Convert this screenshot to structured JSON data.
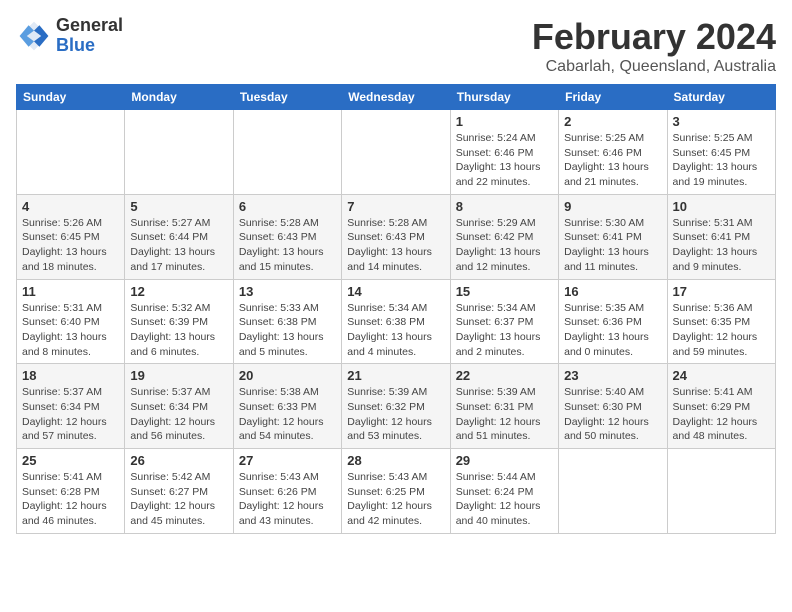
{
  "logo": {
    "general": "General",
    "blue": "Blue"
  },
  "title": "February 2024",
  "location": "Cabarlah, Queensland, Australia",
  "weekdays": [
    "Sunday",
    "Monday",
    "Tuesday",
    "Wednesday",
    "Thursday",
    "Friday",
    "Saturday"
  ],
  "weeks": [
    [
      {
        "day": "",
        "info": ""
      },
      {
        "day": "",
        "info": ""
      },
      {
        "day": "",
        "info": ""
      },
      {
        "day": "",
        "info": ""
      },
      {
        "day": "1",
        "info": "Sunrise: 5:24 AM\nSunset: 6:46 PM\nDaylight: 13 hours\nand 22 minutes."
      },
      {
        "day": "2",
        "info": "Sunrise: 5:25 AM\nSunset: 6:46 PM\nDaylight: 13 hours\nand 21 minutes."
      },
      {
        "day": "3",
        "info": "Sunrise: 5:25 AM\nSunset: 6:45 PM\nDaylight: 13 hours\nand 19 minutes."
      }
    ],
    [
      {
        "day": "4",
        "info": "Sunrise: 5:26 AM\nSunset: 6:45 PM\nDaylight: 13 hours\nand 18 minutes."
      },
      {
        "day": "5",
        "info": "Sunrise: 5:27 AM\nSunset: 6:44 PM\nDaylight: 13 hours\nand 17 minutes."
      },
      {
        "day": "6",
        "info": "Sunrise: 5:28 AM\nSunset: 6:43 PM\nDaylight: 13 hours\nand 15 minutes."
      },
      {
        "day": "7",
        "info": "Sunrise: 5:28 AM\nSunset: 6:43 PM\nDaylight: 13 hours\nand 14 minutes."
      },
      {
        "day": "8",
        "info": "Sunrise: 5:29 AM\nSunset: 6:42 PM\nDaylight: 13 hours\nand 12 minutes."
      },
      {
        "day": "9",
        "info": "Sunrise: 5:30 AM\nSunset: 6:41 PM\nDaylight: 13 hours\nand 11 minutes."
      },
      {
        "day": "10",
        "info": "Sunrise: 5:31 AM\nSunset: 6:41 PM\nDaylight: 13 hours\nand 9 minutes."
      }
    ],
    [
      {
        "day": "11",
        "info": "Sunrise: 5:31 AM\nSunset: 6:40 PM\nDaylight: 13 hours\nand 8 minutes."
      },
      {
        "day": "12",
        "info": "Sunrise: 5:32 AM\nSunset: 6:39 PM\nDaylight: 13 hours\nand 6 minutes."
      },
      {
        "day": "13",
        "info": "Sunrise: 5:33 AM\nSunset: 6:38 PM\nDaylight: 13 hours\nand 5 minutes."
      },
      {
        "day": "14",
        "info": "Sunrise: 5:34 AM\nSunset: 6:38 PM\nDaylight: 13 hours\nand 4 minutes."
      },
      {
        "day": "15",
        "info": "Sunrise: 5:34 AM\nSunset: 6:37 PM\nDaylight: 13 hours\nand 2 minutes."
      },
      {
        "day": "16",
        "info": "Sunrise: 5:35 AM\nSunset: 6:36 PM\nDaylight: 13 hours\nand 0 minutes."
      },
      {
        "day": "17",
        "info": "Sunrise: 5:36 AM\nSunset: 6:35 PM\nDaylight: 12 hours\nand 59 minutes."
      }
    ],
    [
      {
        "day": "18",
        "info": "Sunrise: 5:37 AM\nSunset: 6:34 PM\nDaylight: 12 hours\nand 57 minutes."
      },
      {
        "day": "19",
        "info": "Sunrise: 5:37 AM\nSunset: 6:34 PM\nDaylight: 12 hours\nand 56 minutes."
      },
      {
        "day": "20",
        "info": "Sunrise: 5:38 AM\nSunset: 6:33 PM\nDaylight: 12 hours\nand 54 minutes."
      },
      {
        "day": "21",
        "info": "Sunrise: 5:39 AM\nSunset: 6:32 PM\nDaylight: 12 hours\nand 53 minutes."
      },
      {
        "day": "22",
        "info": "Sunrise: 5:39 AM\nSunset: 6:31 PM\nDaylight: 12 hours\nand 51 minutes."
      },
      {
        "day": "23",
        "info": "Sunrise: 5:40 AM\nSunset: 6:30 PM\nDaylight: 12 hours\nand 50 minutes."
      },
      {
        "day": "24",
        "info": "Sunrise: 5:41 AM\nSunset: 6:29 PM\nDaylight: 12 hours\nand 48 minutes."
      }
    ],
    [
      {
        "day": "25",
        "info": "Sunrise: 5:41 AM\nSunset: 6:28 PM\nDaylight: 12 hours\nand 46 minutes."
      },
      {
        "day": "26",
        "info": "Sunrise: 5:42 AM\nSunset: 6:27 PM\nDaylight: 12 hours\nand 45 minutes."
      },
      {
        "day": "27",
        "info": "Sunrise: 5:43 AM\nSunset: 6:26 PM\nDaylight: 12 hours\nand 43 minutes."
      },
      {
        "day": "28",
        "info": "Sunrise: 5:43 AM\nSunset: 6:25 PM\nDaylight: 12 hours\nand 42 minutes."
      },
      {
        "day": "29",
        "info": "Sunrise: 5:44 AM\nSunset: 6:24 PM\nDaylight: 12 hours\nand 40 minutes."
      },
      {
        "day": "",
        "info": ""
      },
      {
        "day": "",
        "info": ""
      }
    ]
  ]
}
